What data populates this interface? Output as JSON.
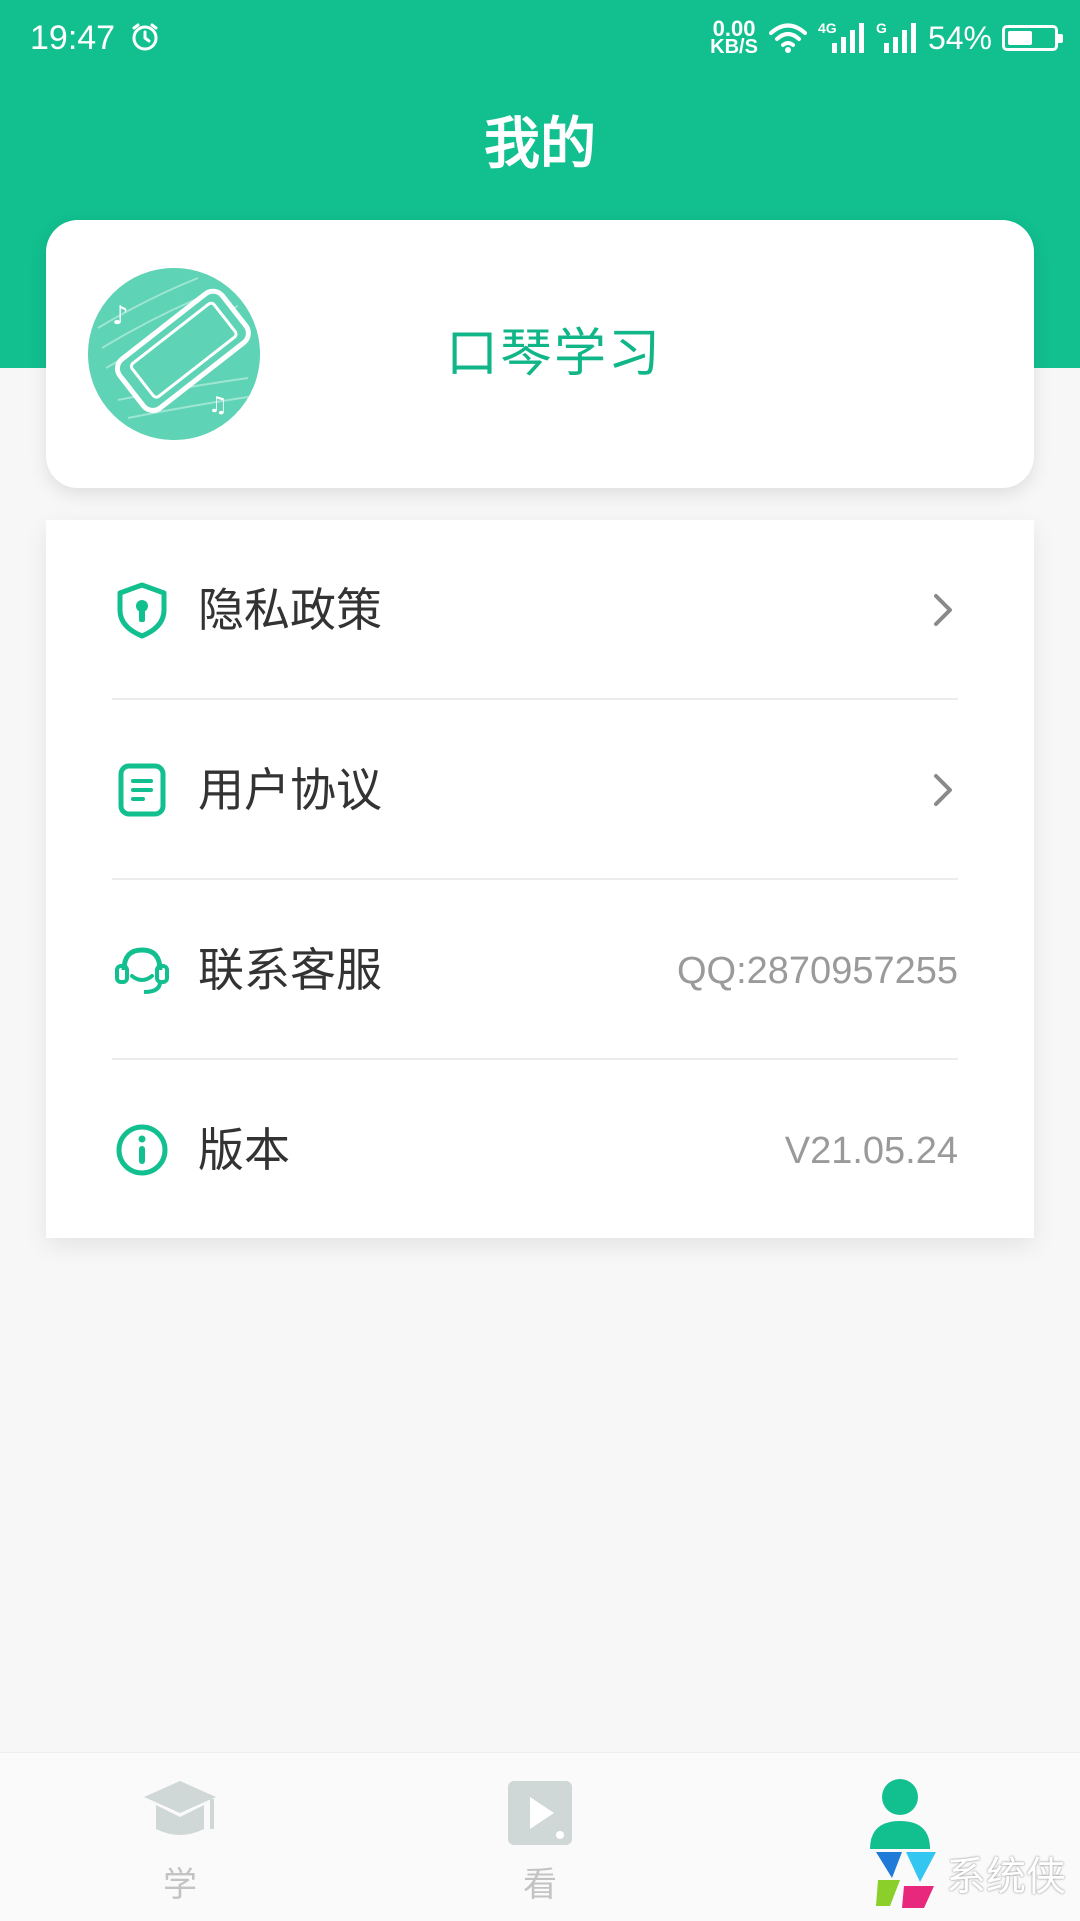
{
  "status_bar": {
    "time": "19:47",
    "net_speed_value": "0.00",
    "net_speed_unit": "KB/S",
    "signal1_label": "4G",
    "signal2_label": "G",
    "battery": "54%",
    "battery_level": 0.54
  },
  "header": {
    "title": "我的"
  },
  "profile": {
    "name": "口琴学习",
    "avatar_icon": "harmonica-phone-music-logo"
  },
  "menu": {
    "items": [
      {
        "label": "隐私政策",
        "icon": "shield-keyhole-icon",
        "value": "",
        "has_chevron": true
      },
      {
        "label": "用户协议",
        "icon": "document-icon",
        "value": "",
        "has_chevron": true
      },
      {
        "label": "联系客服",
        "icon": "headset-icon",
        "value": "QQ:2870957255",
        "has_chevron": false
      },
      {
        "label": "版本",
        "icon": "info-icon",
        "value": "V21.05.24",
        "has_chevron": false
      }
    ]
  },
  "tabbar": {
    "tabs": [
      {
        "label": "学",
        "icon": "graduation-cap-icon",
        "active": false
      },
      {
        "label": "看",
        "icon": "video-play-icon",
        "active": false
      },
      {
        "label": "",
        "icon": "user-icon",
        "active": true
      }
    ]
  },
  "watermark": {
    "text": "系统侠"
  },
  "colors": {
    "brand": "#12bf8f",
    "background": "#f7f7f7",
    "muted": "#c3c3c3"
  }
}
